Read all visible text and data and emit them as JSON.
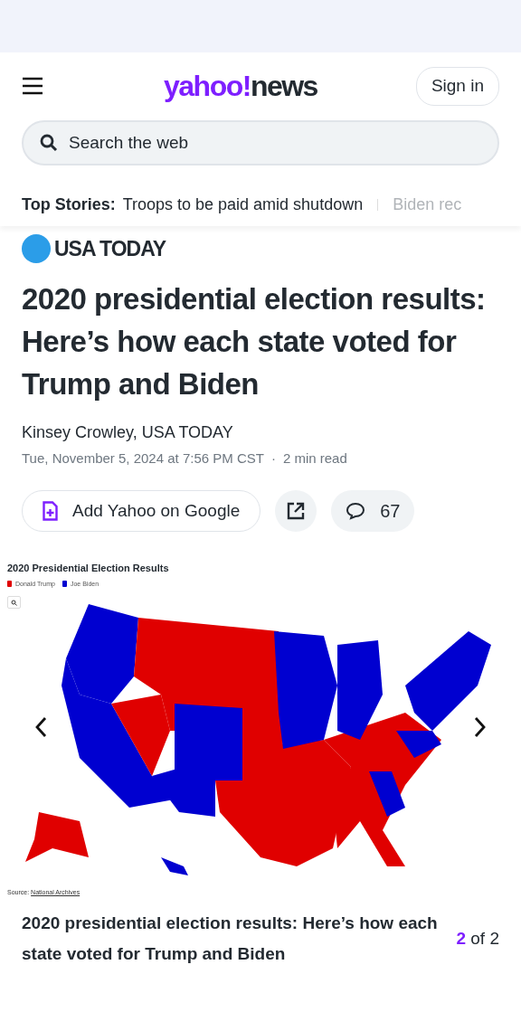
{
  "header": {
    "logo": {
      "brand": "yahoo!",
      "product": "news"
    },
    "sign_in": "Sign in",
    "search": {
      "placeholder": "Search the web"
    }
  },
  "top_stories": {
    "label": "Top Stories:",
    "items": [
      {
        "text": "Troops to be paid amid shutdown",
        "faded": false
      },
      {
        "text": "Biden rec",
        "faded": true
      }
    ]
  },
  "article": {
    "source": "USA TODAY",
    "title": "2020 presidential election results: Here’s how each state voted for Trump and Biden",
    "author": "Kinsey Crowley, USA TODAY",
    "date": "Tue, November 5, 2024 at 7:56 PM CST",
    "meta_sep": "·",
    "read_time": "2 min read",
    "actions": {
      "follow": "Add Yahoo on Google",
      "comments": "67"
    }
  },
  "gallery": {
    "image": {
      "title": "2020 Presidential Election Results",
      "legend": [
        {
          "label": "Donald Trump",
          "color": "#e00000"
        },
        {
          "label": "Joe Biden",
          "color": "#0000d0"
        }
      ],
      "source_label": "Source:",
      "source_link": "National Archives"
    },
    "caption": "2020 presidential election results: Here’s how each state voted for Trump and Biden",
    "counter": {
      "current": "2",
      "total": "2",
      "sep": "of"
    }
  }
}
